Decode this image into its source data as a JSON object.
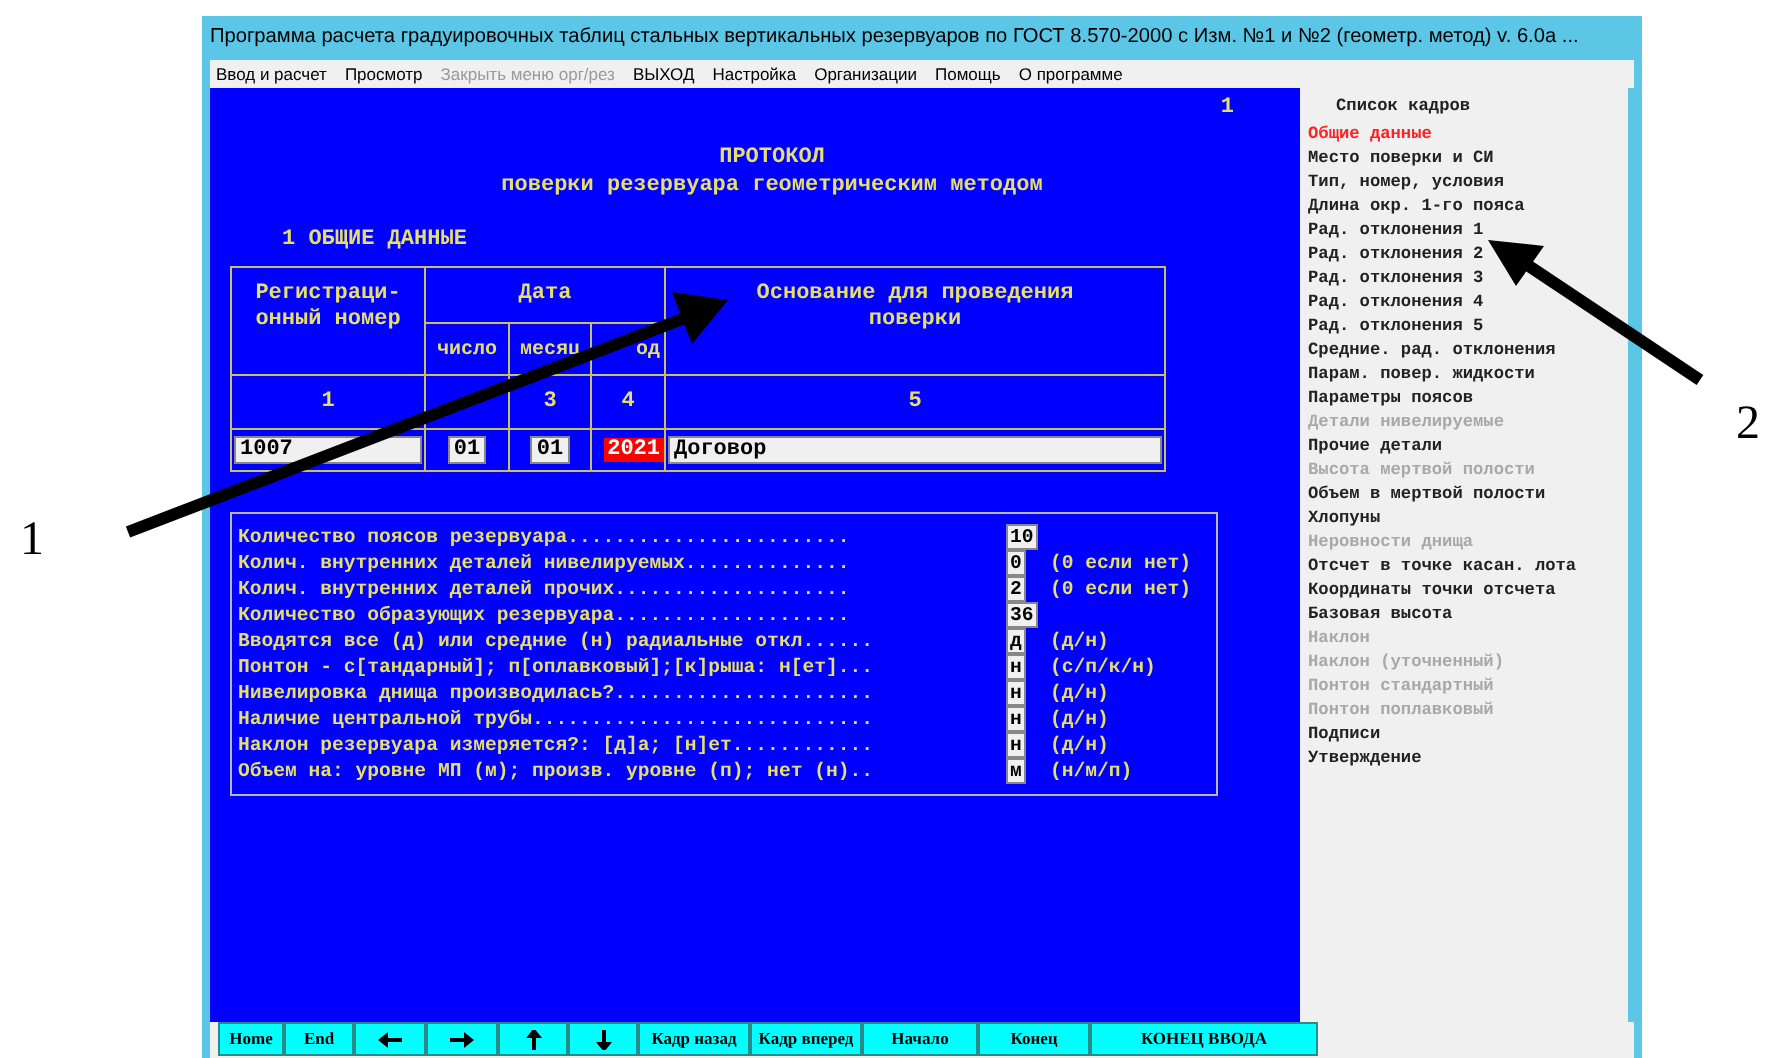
{
  "window": {
    "title": "Программа расчета градуировочных таблиц стальных вертикальных резервуаров по ГОСТ 8.570-2000 с Изм. №1 и №2 (геометр. метод) v. 6.0a ..."
  },
  "menu": [
    {
      "label": "Ввод и расчет",
      "disabled": false
    },
    {
      "label": "Просмотр",
      "disabled": false
    },
    {
      "label": "Закрыть меню орг/рез",
      "disabled": true
    },
    {
      "label": "ВЫХОД",
      "disabled": false
    },
    {
      "label": "Настройка",
      "disabled": false
    },
    {
      "label": "Организации",
      "disabled": false
    },
    {
      "label": "Помощь",
      "disabled": false
    },
    {
      "label": "О программе",
      "disabled": false
    }
  ],
  "page_number": "1",
  "protocol": {
    "title": "ПРОТОКОЛ",
    "subtitle": "поверки резервуара геометрическим методом",
    "section": "1 ОБЩИЕ ДАННЫЕ"
  },
  "table": {
    "reg_header": "Регистраци-\nонный номер",
    "date_header": "Дата",
    "date_columns": [
      "число",
      "месяц",
      "од"
    ],
    "basis_header": "Основание для проведения\nповерки",
    "numbers": {
      "col_1": "1",
      "col_3": "3",
      "col_4": "4",
      "col_5": "5"
    },
    "row": {
      "reg_number": "1007",
      "dates": [
        {
          "value": "01",
          "highlighted": false
        },
        {
          "value": "01",
          "highlighted": false
        },
        {
          "value": "2021",
          "highlighted": true
        }
      ],
      "basis": "Договор"
    }
  },
  "form": {
    "rows": [
      {
        "label": "Количество поясов резервуара........................",
        "value": "10"
      },
      {
        "label": "Колич. внутренних деталей нивелируемых..............",
        "value": "0",
        "hint": "(0 если нет)"
      },
      {
        "label": "Колич. внутренних деталей прочих....................",
        "value": "2",
        "hint": "(0 если нет)"
      },
      {
        "label": "Количество образующих резервуара....................",
        "value": "36"
      },
      {
        "label": "Вводятся все (д) или средние (н) радиальные откл......",
        "value": "д",
        "hint": "(д/н)"
      },
      {
        "label": "Понтон - с[тандарный]; п[оплавковый];[к]рыша: н[ет]...",
        "value": "н",
        "hint": "(с/п/к/н)"
      },
      {
        "label": "Нивелировка днища производилась?......................",
        "value": "н",
        "hint": "(д/н)"
      },
      {
        "label": "Наличие центральной трубы.............................",
        "value": "н",
        "hint": "(д/н)"
      },
      {
        "label": "Наклон резервуара измеряется?: [д]а; [н]ет............",
        "value": "н",
        "hint": "(д/н)"
      },
      {
        "label": "Объем на: уровне МП (м); произв. уровне (п); нет (н)..",
        "value": "м",
        "hint": "(н/м/п)"
      }
    ]
  },
  "frame_list": {
    "title": "Список кадров",
    "items": [
      {
        "label": "Общие данные",
        "selected": true,
        "disabled": false
      },
      {
        "label": "Место поверки и СИ",
        "selected": false,
        "disabled": false
      },
      {
        "label": "Тип, номер, условия",
        "selected": false,
        "disabled": false
      },
      {
        "label": "Длина окр. 1-го пояса",
        "selected": false,
        "disabled": false
      },
      {
        "label": "Рад. отклонения 1",
        "selected": false,
        "disabled": false
      },
      {
        "label": "Рад. отклонения 2",
        "selected": false,
        "disabled": false
      },
      {
        "label": "Рад. отклонения 3",
        "selected": false,
        "disabled": false
      },
      {
        "label": "Рад. отклонения 4",
        "selected": false,
        "disabled": false
      },
      {
        "label": "Рад. отклонения 5",
        "selected": false,
        "disabled": false
      },
      {
        "label": "Средние. рад. отклонения",
        "selected": false,
        "disabled": false
      },
      {
        "label": "Парам. повер. жидкости",
        "selected": false,
        "disabled": false
      },
      {
        "label": "Параметры поясов",
        "selected": false,
        "disabled": false
      },
      {
        "label": "Детали нивелируемые",
        "selected": false,
        "disabled": true
      },
      {
        "label": "Прочие детали",
        "selected": false,
        "disabled": false
      },
      {
        "label": "Высота мертвой полости",
        "selected": false,
        "disabled": true
      },
      {
        "label": "Объем в мертвой полости",
        "selected": false,
        "disabled": false
      },
      {
        "label": "Хлопуны",
        "selected": false,
        "disabled": false
      },
      {
        "label": "Неровности днища",
        "selected": false,
        "disabled": true
      },
      {
        "label": "Отсчет в точке касан. лота",
        "selected": false,
        "disabled": false
      },
      {
        "label": "Координаты точки отсчета",
        "selected": false,
        "disabled": false
      },
      {
        "label": "Базовая высота",
        "selected": false,
        "disabled": false
      },
      {
        "label": "Наклон",
        "selected": false,
        "disabled": true
      },
      {
        "label": "Наклон (уточненный)",
        "selected": false,
        "disabled": true
      },
      {
        "label": "Понтон стандартный",
        "selected": false,
        "disabled": true
      },
      {
        "label": "Понтон поплавковый",
        "selected": false,
        "disabled": true
      },
      {
        "label": "Подписи",
        "selected": false,
        "disabled": false
      },
      {
        "label": "Утверждение",
        "selected": false,
        "disabled": false
      }
    ]
  },
  "buttons": [
    {
      "kind": "text",
      "label": "Home"
    },
    {
      "kind": "text",
      "label": "End"
    },
    {
      "kind": "arrow-left"
    },
    {
      "kind": "arrow-right"
    },
    {
      "kind": "arrow-up"
    },
    {
      "kind": "arrow-down"
    },
    {
      "kind": "text",
      "label": "Кадр назад"
    },
    {
      "kind": "text",
      "label": "Кадр вперед"
    },
    {
      "kind": "text",
      "label": "Начало"
    },
    {
      "kind": "text",
      "label": "Конец"
    },
    {
      "kind": "text",
      "label": "КОНЕЦ ВВОДА",
      "wide": true
    }
  ],
  "callouts": [
    {
      "label": "1"
    },
    {
      "label": "2"
    }
  ]
}
